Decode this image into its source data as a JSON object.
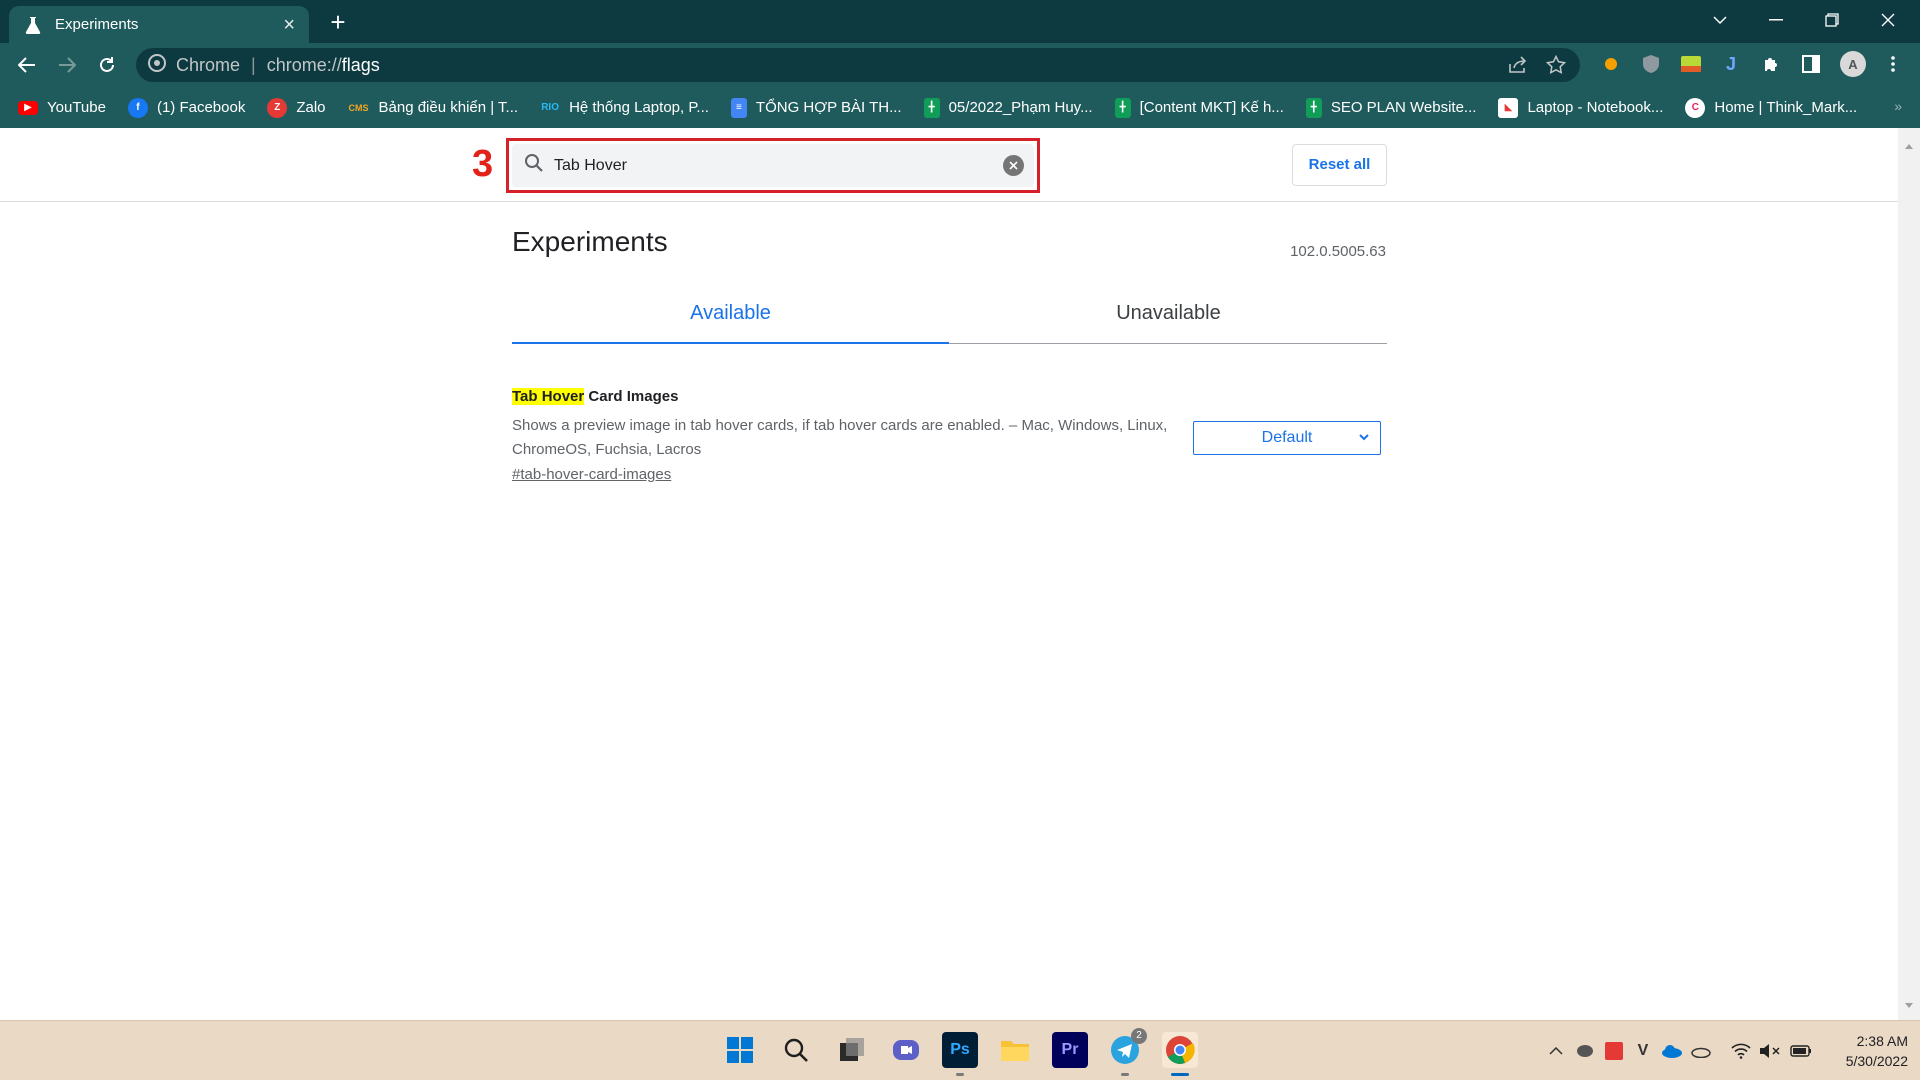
{
  "browser": {
    "tab_title": "Experiments",
    "omnibox": {
      "site_label": "Chrome",
      "url_host": "chrome://",
      "url_path": "flags"
    },
    "bookmarks": [
      {
        "label": "YouTube",
        "icon": "youtube-icon",
        "color": "#ff0000"
      },
      {
        "label": "(1) Facebook",
        "icon": "facebook-icon",
        "color": "#1877f2"
      },
      {
        "label": "Zalo",
        "icon": "zalo-icon",
        "color": "#e53935"
      },
      {
        "label": "Bảng điều khiển | T...",
        "icon": "cms-icon",
        "color": "#f5a623"
      },
      {
        "label": "Hệ thống Laptop, P...",
        "icon": "rio-icon",
        "color": "#29b6f6"
      },
      {
        "label": "TỔNG HỢP BÀI TH...",
        "icon": "google-docs-icon",
        "color": "#4285f4"
      },
      {
        "label": "05/2022_Phạm Huy...",
        "icon": "google-sheets-icon",
        "color": "#0f9d58"
      },
      {
        "label": "[Content MKT] Kế h...",
        "icon": "google-sheets-icon",
        "color": "#0f9d58"
      },
      {
        "label": "SEO PLAN Website...",
        "icon": "google-sheets-icon",
        "color": "#0f9d58"
      },
      {
        "label": "Laptop - Notebook...",
        "icon": "laptop-site-icon",
        "color": "#ffffff"
      },
      {
        "label": "Home | Think_Mark...",
        "icon": "think-mark-icon",
        "color": "#ffffff"
      }
    ],
    "bookmarks_more": "»"
  },
  "annotation": {
    "label": "3",
    "color": "#e2231a"
  },
  "flags": {
    "search_value": "Tab Hover",
    "reset_label": "Reset all",
    "title": "Experiments",
    "version": "102.0.5005.63",
    "tabs": {
      "available": "Available",
      "unavailable": "Unavailable"
    },
    "accent_color": "#1a73e8",
    "item": {
      "name_highlight": "Tab Hover",
      "name_rest": " Card Images",
      "description": "Shows a preview image in tab hover cards, if tab hover cards are enabled. – Mac, Windows, Linux, ChromeOS, Fuchsia, Lacros",
      "link": "#tab-hover-card-images",
      "select_value": "Default"
    }
  },
  "taskbar": {
    "apps": [
      "start-icon",
      "search-icon",
      "task-view-icon",
      "meet-icon",
      "photoshop-icon",
      "file-explorer-icon",
      "premiere-icon",
      "telegram-icon",
      "chrome-icon"
    ],
    "telegram_badge": "2",
    "photoshop_label": "Ps",
    "premiere_label": "Pr",
    "time": "2:38 AM",
    "date": "5/30/2022"
  }
}
